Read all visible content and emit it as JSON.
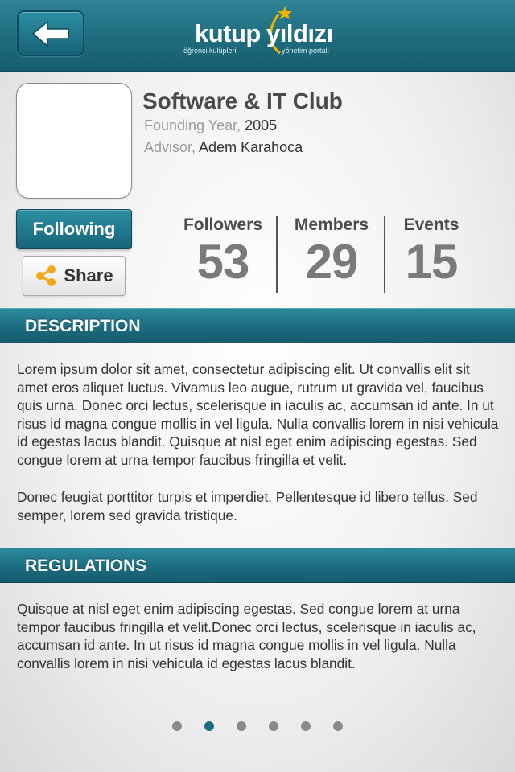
{
  "header": {
    "logo": {
      "word_left": "kutup",
      "word_right": "yıldızı",
      "sub_left": "öğrenci kulüpleri",
      "sub_right": "yönetim portalı"
    },
    "back_icon": "arrow-left-icon"
  },
  "club": {
    "name": "Software & IT Club",
    "founding_label": "Founding Year,",
    "founding_value": "2005",
    "advisor_label": "Advisor,",
    "advisor_value": "Adem Karahoca"
  },
  "actions": {
    "follow_label": "Following",
    "share_label": "Share",
    "share_icon": "share-icon"
  },
  "stats": [
    {
      "label": "Followers",
      "value": "53"
    },
    {
      "label": "Members",
      "value": "29"
    },
    {
      "label": "Events",
      "value": "15"
    }
  ],
  "description": {
    "title": "DESCRIPTION",
    "paragraphs": [
      "Lorem ipsum dolor sit amet, consectetur adipiscing elit. Ut convallis elit sit amet eros aliquet luctus. Vivamus leo augue, rutrum ut gravida vel, faucibus quis urna. Donec orci lectus, scelerisque in iaculis ac, accumsan id ante. In ut risus id magna congue mollis in vel ligula. Nulla convallis lorem in nisi vehicula id egestas lacus blandit. Quisque at nisl eget enim adipiscing egestas. Sed congue lorem at urna tempor faucibus fringilla et velit.",
      "Donec feugiat porttitor turpis et imperdiet. Pellentesque id libero tellus. Sed semper, lorem sed gravida tristique."
    ]
  },
  "regulations": {
    "title": "REGULATIONS",
    "paragraphs": [
      "Quisque at nisl eget enim adipiscing egestas. Sed congue lorem at urna tempor faucibus fringilla et velit.Donec orci lectus, scelerisque in iaculis ac, accumsan id ante. In ut risus id magna congue mollis in vel ligula. Nulla convallis lorem in nisi vehicula id egestas lacus blandit."
    ]
  },
  "pagination": {
    "total": 6,
    "active_index": 1
  },
  "colors": {
    "brand_teal": "#1f6c7e",
    "star": "#f3b400",
    "share_icon": "#f0a818",
    "inactive_dot": "#8a8a8a"
  }
}
